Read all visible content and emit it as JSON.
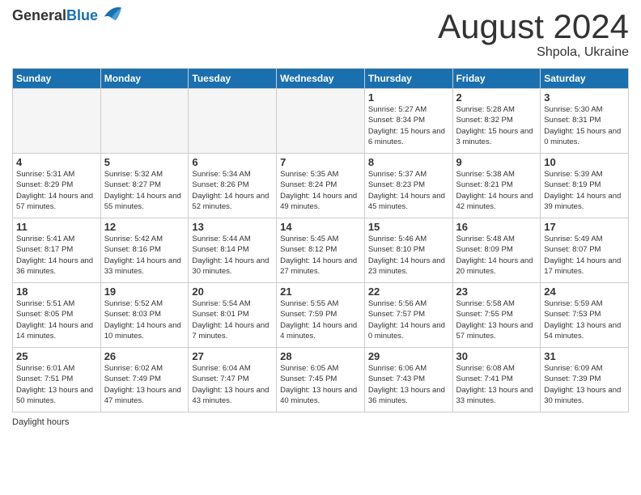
{
  "header": {
    "logo_general": "General",
    "logo_blue": "Blue",
    "month": "August 2024",
    "location": "Shpola, Ukraine"
  },
  "days_of_week": [
    "Sunday",
    "Monday",
    "Tuesday",
    "Wednesday",
    "Thursday",
    "Friday",
    "Saturday"
  ],
  "weeks": [
    [
      {
        "day": "",
        "info": ""
      },
      {
        "day": "",
        "info": ""
      },
      {
        "day": "",
        "info": ""
      },
      {
        "day": "",
        "info": ""
      },
      {
        "day": "1",
        "info": "Sunrise: 5:27 AM\nSunset: 8:34 PM\nDaylight: 15 hours and 6 minutes."
      },
      {
        "day": "2",
        "info": "Sunrise: 5:28 AM\nSunset: 8:32 PM\nDaylight: 15 hours and 3 minutes."
      },
      {
        "day": "3",
        "info": "Sunrise: 5:30 AM\nSunset: 8:31 PM\nDaylight: 15 hours and 0 minutes."
      }
    ],
    [
      {
        "day": "4",
        "info": "Sunrise: 5:31 AM\nSunset: 8:29 PM\nDaylight: 14 hours and 57 minutes."
      },
      {
        "day": "5",
        "info": "Sunrise: 5:32 AM\nSunset: 8:27 PM\nDaylight: 14 hours and 55 minutes."
      },
      {
        "day": "6",
        "info": "Sunrise: 5:34 AM\nSunset: 8:26 PM\nDaylight: 14 hours and 52 minutes."
      },
      {
        "day": "7",
        "info": "Sunrise: 5:35 AM\nSunset: 8:24 PM\nDaylight: 14 hours and 49 minutes."
      },
      {
        "day": "8",
        "info": "Sunrise: 5:37 AM\nSunset: 8:23 PM\nDaylight: 14 hours and 45 minutes."
      },
      {
        "day": "9",
        "info": "Sunrise: 5:38 AM\nSunset: 8:21 PM\nDaylight: 14 hours and 42 minutes."
      },
      {
        "day": "10",
        "info": "Sunrise: 5:39 AM\nSunset: 8:19 PM\nDaylight: 14 hours and 39 minutes."
      }
    ],
    [
      {
        "day": "11",
        "info": "Sunrise: 5:41 AM\nSunset: 8:17 PM\nDaylight: 14 hours and 36 minutes."
      },
      {
        "day": "12",
        "info": "Sunrise: 5:42 AM\nSunset: 8:16 PM\nDaylight: 14 hours and 33 minutes."
      },
      {
        "day": "13",
        "info": "Sunrise: 5:44 AM\nSunset: 8:14 PM\nDaylight: 14 hours and 30 minutes."
      },
      {
        "day": "14",
        "info": "Sunrise: 5:45 AM\nSunset: 8:12 PM\nDaylight: 14 hours and 27 minutes."
      },
      {
        "day": "15",
        "info": "Sunrise: 5:46 AM\nSunset: 8:10 PM\nDaylight: 14 hours and 23 minutes."
      },
      {
        "day": "16",
        "info": "Sunrise: 5:48 AM\nSunset: 8:09 PM\nDaylight: 14 hours and 20 minutes."
      },
      {
        "day": "17",
        "info": "Sunrise: 5:49 AM\nSunset: 8:07 PM\nDaylight: 14 hours and 17 minutes."
      }
    ],
    [
      {
        "day": "18",
        "info": "Sunrise: 5:51 AM\nSunset: 8:05 PM\nDaylight: 14 hours and 14 minutes."
      },
      {
        "day": "19",
        "info": "Sunrise: 5:52 AM\nSunset: 8:03 PM\nDaylight: 14 hours and 10 minutes."
      },
      {
        "day": "20",
        "info": "Sunrise: 5:54 AM\nSunset: 8:01 PM\nDaylight: 14 hours and 7 minutes."
      },
      {
        "day": "21",
        "info": "Sunrise: 5:55 AM\nSunset: 7:59 PM\nDaylight: 14 hours and 4 minutes."
      },
      {
        "day": "22",
        "info": "Sunrise: 5:56 AM\nSunset: 7:57 PM\nDaylight: 14 hours and 0 minutes."
      },
      {
        "day": "23",
        "info": "Sunrise: 5:58 AM\nSunset: 7:55 PM\nDaylight: 13 hours and 57 minutes."
      },
      {
        "day": "24",
        "info": "Sunrise: 5:59 AM\nSunset: 7:53 PM\nDaylight: 13 hours and 54 minutes."
      }
    ],
    [
      {
        "day": "25",
        "info": "Sunrise: 6:01 AM\nSunset: 7:51 PM\nDaylight: 13 hours and 50 minutes."
      },
      {
        "day": "26",
        "info": "Sunrise: 6:02 AM\nSunset: 7:49 PM\nDaylight: 13 hours and 47 minutes."
      },
      {
        "day": "27",
        "info": "Sunrise: 6:04 AM\nSunset: 7:47 PM\nDaylight: 13 hours and 43 minutes."
      },
      {
        "day": "28",
        "info": "Sunrise: 6:05 AM\nSunset: 7:45 PM\nDaylight: 13 hours and 40 minutes."
      },
      {
        "day": "29",
        "info": "Sunrise: 6:06 AM\nSunset: 7:43 PM\nDaylight: 13 hours and 36 minutes."
      },
      {
        "day": "30",
        "info": "Sunrise: 6:08 AM\nSunset: 7:41 PM\nDaylight: 13 hours and 33 minutes."
      },
      {
        "day": "31",
        "info": "Sunrise: 6:09 AM\nSunset: 7:39 PM\nDaylight: 13 hours and 30 minutes."
      }
    ]
  ],
  "footer": {
    "daylight_label": "Daylight hours"
  }
}
